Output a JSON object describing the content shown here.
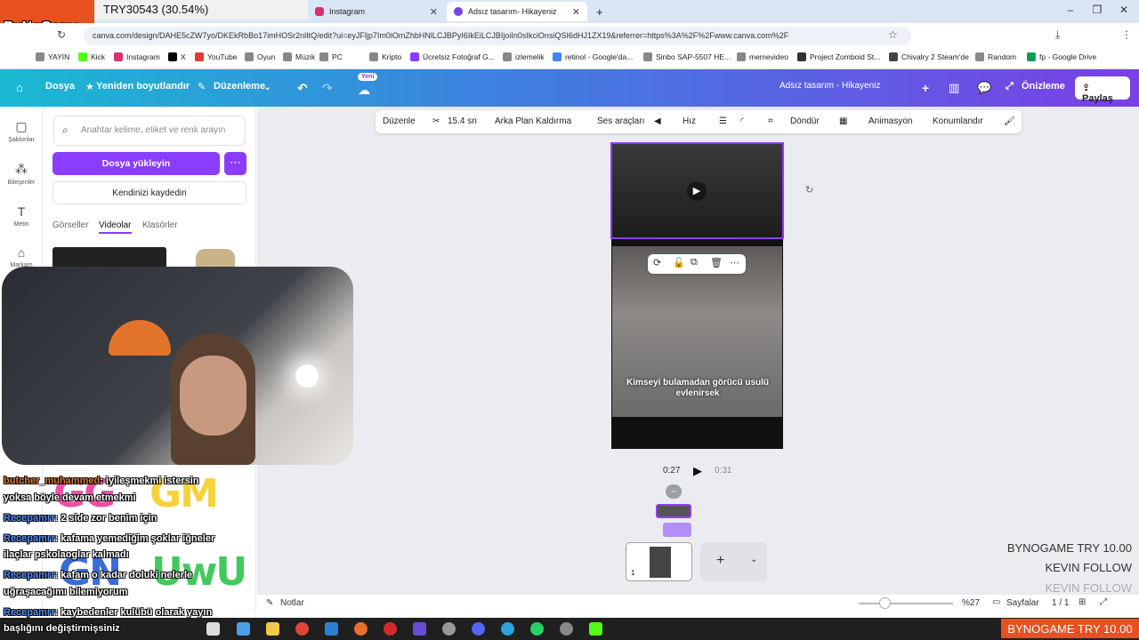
{
  "overlay": {
    "try_counter": "TRY30543 (30.54%)",
    "logo": "ByNoGame",
    "lines": [
      "BYNOGAME  TRY 10.00",
      "KEVIN  FOLLOW",
      "KEVIN  FOLLOW"
    ],
    "bottom_badge": "BYNOGAME  TRY 10.00"
  },
  "browser": {
    "tabs": [
      {
        "label": "Instagram",
        "active": false
      },
      {
        "label": "Adsız tasarım- Hikayeniz",
        "active": true
      }
    ],
    "new_tab": "+",
    "url": "canva.com/design/DAHE5cZW7yo/DKEkRbBo17imHOSr2nlItQ/edit?ui=eyJFljp7Im0iOmZhbHNlLCJBPyI6IkEiLCJBIjoiIn0sIkciOnsiQSI6dHJ1ZX19&referrer=https%3A%2F%2Fwww.canva.com%2F",
    "bookmarks": [
      "YAYIN",
      "Kick",
      "Instagram",
      "X",
      "YouTube",
      "Oyun",
      "Müzik",
      "PC",
      "Kripto",
      "Ücretsiz Fotoğraf G...",
      "izlemelik",
      "retinol - Google'da...",
      "Sinbo SAP-5507 HE...",
      "memevideo",
      "Project Zomboid St...",
      "Chivalry 2 Steam'de",
      "Random",
      "fp - Google Drive"
    ]
  },
  "canva": {
    "menu": {
      "file": "Dosya",
      "resize": "Yeniden boyutlandır",
      "editing": "Düzenleme",
      "new_badge": "Yeni"
    },
    "design_title": "Adsız tasarım - Hikayeniz",
    "present": "Önizleme",
    "share": "Paylaş",
    "rail": [
      "Şablonlar",
      "Bileşenler",
      "Metin",
      "Markam"
    ],
    "panel": {
      "search_placeholder": "Anahtar kelime, etiket ve renk arayın",
      "upload": "Dosya yükleyin",
      "record": "Kendinizi kaydedin",
      "tabs": [
        "Görseller",
        "Videolar",
        "Klasörler"
      ]
    },
    "toolbar": [
      "Düzenle",
      "15.4 sn",
      "Arka Plan Kaldırma",
      "Ses araçları",
      "Hız",
      "Döndür",
      "Animasyon",
      "Konumlandır"
    ],
    "caption": "Kimseyi bulamadan görücü usulü evlenirsek",
    "time_current": "0:27",
    "time_total": "0:31",
    "page_number": "1",
    "notes": "Notlar",
    "zoom": "%27",
    "pages": "Sayfalar",
    "page_count": "1 / 1"
  },
  "chat": [
    {
      "user": "butcher_muhammed",
      "text": ": iyileşmekmi istersin yoksa böyle devam etmekmi",
      "cont": "yoksa böyle devam etmekmi"
    },
    {
      "user": "Recepamrr",
      "text": ": 2 side zor benim için"
    },
    {
      "user": "Recepamrr",
      "text": ": kafama yemediğim şoklar iğneler",
      "cont": "ilaçlar pskolaoglar kalmadı"
    },
    {
      "user": "Recepamrr",
      "text": ": kafam o kadar doluki nelerle",
      "cont": "uğraşacağımı bilemiyorum"
    },
    {
      "user": "Recepamrr",
      "text": ": kaybedenler kulübü olarak yayın",
      "cont": "başlığını değiştirmişsiniz"
    }
  ],
  "emotes": [
    "GG",
    "GM",
    "GN",
    "UwU"
  ],
  "colors": {
    "accent": "#8b3dff",
    "overlay_orange": "#e8501e"
  }
}
